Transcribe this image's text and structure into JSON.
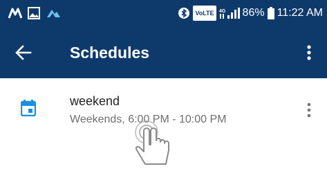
{
  "status_bar": {
    "left_icons": [
      "m-app-icon",
      "gallery-icon",
      "airtel-icon"
    ],
    "volte": "VoLTE",
    "battery": "86%",
    "time": "11:22 AM"
  },
  "app_bar": {
    "title": "Schedules"
  },
  "schedules": [
    {
      "name": "weekend",
      "detail": "Weekends, 6:00 PM - 10:00 PM"
    }
  ],
  "colors": {
    "app_bar": "#0e3a6b",
    "calendar_icon": "#1a8fe3"
  }
}
